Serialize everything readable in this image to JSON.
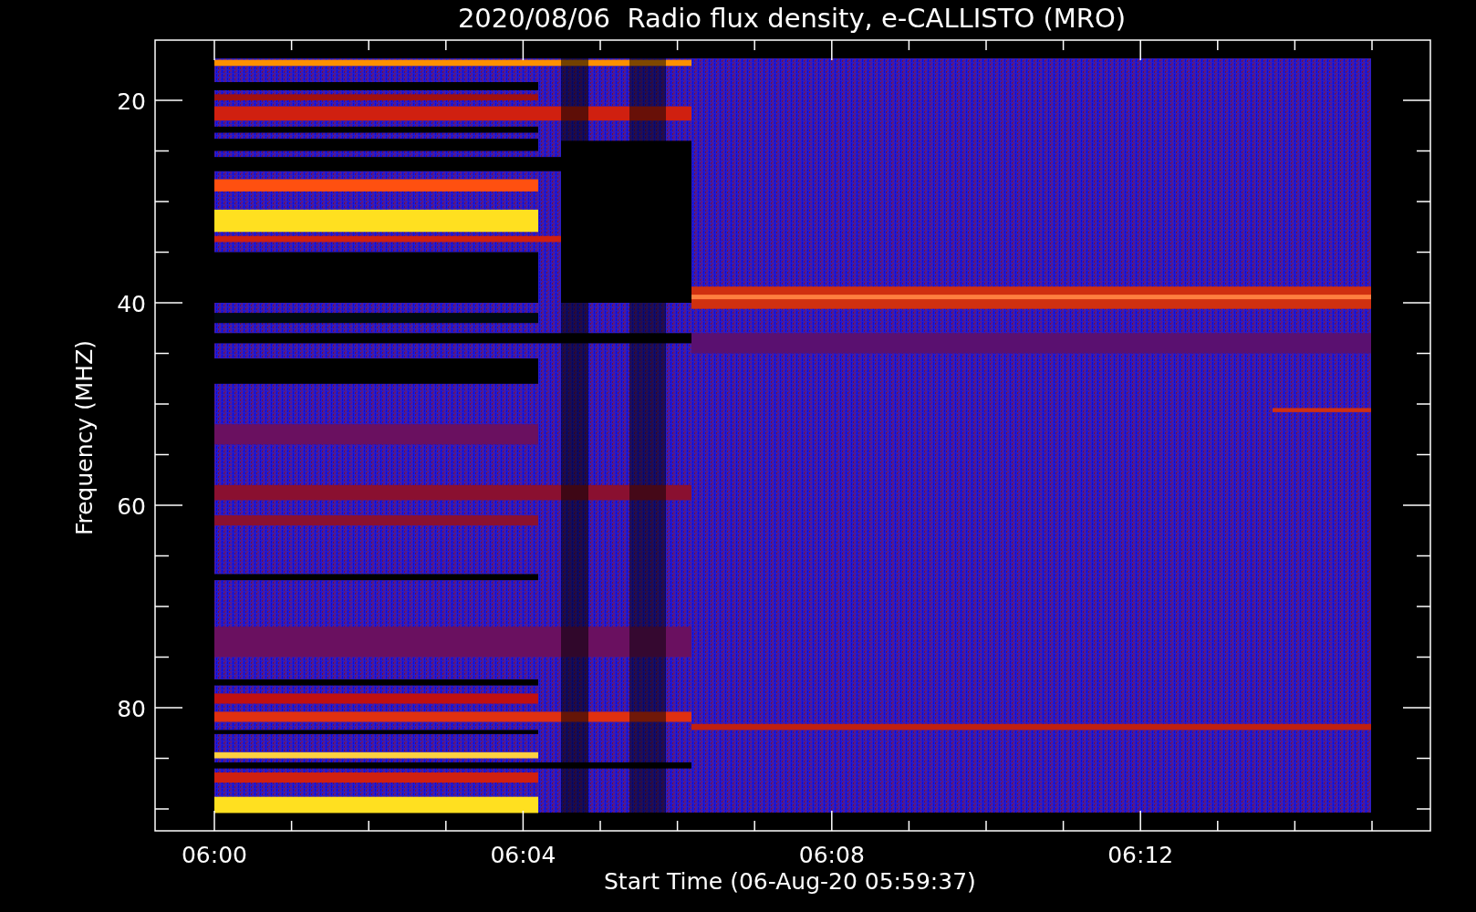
{
  "plot": {
    "title": "2020/08/06  Radio flux density, e-CALLISTO (MRO)",
    "xlabel": "Start Time (06-Aug-20 05:59:37)",
    "ylabel": "Frequency (MHZ)",
    "xticks": [
      "06:00",
      "06:04",
      "06:08",
      "06:12"
    ],
    "yticks": [
      "20",
      "40",
      "60",
      "80"
    ]
  }
}
